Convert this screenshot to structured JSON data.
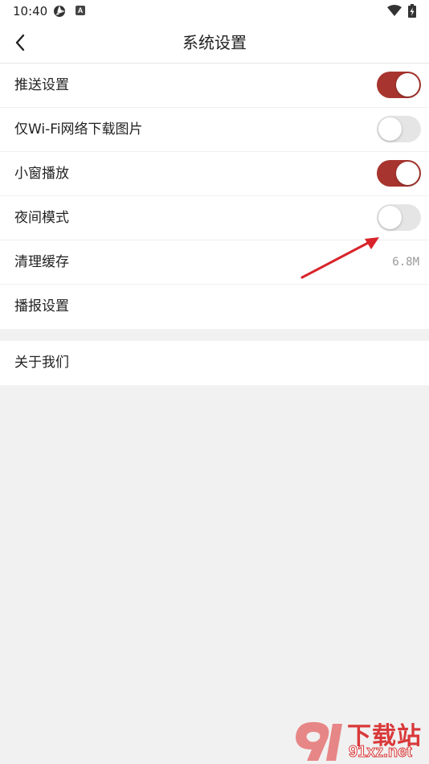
{
  "status_bar": {
    "time": "10:40",
    "app_badge": "A"
  },
  "header": {
    "title": "系统设置"
  },
  "settings": {
    "rows": [
      {
        "label": "推送设置",
        "type": "toggle",
        "on": true
      },
      {
        "label": "仅Wi-Fi网络下载图片",
        "type": "toggle",
        "on": false
      },
      {
        "label": "小窗播放",
        "type": "toggle",
        "on": true
      },
      {
        "label": "夜间模式",
        "type": "toggle",
        "on": false
      },
      {
        "label": "清理缓存",
        "type": "value",
        "value": "6.8M"
      },
      {
        "label": "播报设置",
        "type": "link"
      }
    ],
    "about": {
      "label": "关于我们"
    }
  },
  "colors": {
    "toggle_on": "#a7342e",
    "toggle_off": "#e5e5e5",
    "annotation_arrow": "#d8232a",
    "watermark": "#d9393a"
  },
  "watermark": {
    "logo_text": "91下载站",
    "site": "91xz.net"
  }
}
